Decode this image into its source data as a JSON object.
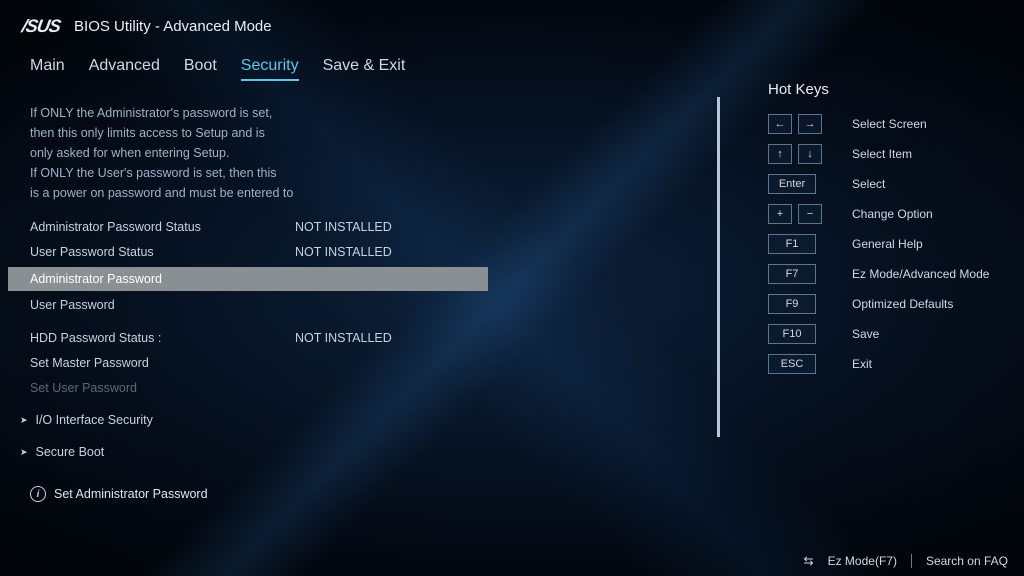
{
  "header": {
    "logo": "/SUS",
    "title": "BIOS Utility - Advanced Mode"
  },
  "tabs": [
    {
      "label": "Main"
    },
    {
      "label": "Advanced"
    },
    {
      "label": "Boot"
    },
    {
      "label": "Security",
      "active": true
    },
    {
      "label": "Save & Exit"
    }
  ],
  "security": {
    "description": [
      "If ONLY the Administrator's password is set,",
      "then this only limits access to Setup and is",
      "only asked for when entering Setup.",
      "If ONLY the User's password is set, then this",
      "is a power on password and must be entered to"
    ],
    "admin_status_label": "Administrator Password Status",
    "admin_status_value": "NOT INSTALLED",
    "user_status_label": "User Password Status",
    "user_status_value": "NOT INSTALLED",
    "admin_password": "Administrator Password",
    "user_password": "User Password",
    "hdd_status_label": "HDD Password Status  :",
    "hdd_status_value": "NOT INSTALLED",
    "set_master": "Set Master Password",
    "set_user": "Set User Password",
    "io_interface": "I/O Interface Security",
    "secure_boot": "Secure Boot",
    "info_text": "Set Administrator Password"
  },
  "hotkeys": {
    "title": "Hot Keys",
    "rows": [
      {
        "keys": [
          "←",
          "→"
        ],
        "label": "Select Screen"
      },
      {
        "keys": [
          "↑",
          "↓"
        ],
        "label": "Select Item"
      },
      {
        "keys": [
          "Enter"
        ],
        "wide": true,
        "label": "Select"
      },
      {
        "keys": [
          "+",
          "−"
        ],
        "label": "Change Option"
      },
      {
        "keys": [
          "F1"
        ],
        "wide": true,
        "label": "General Help"
      },
      {
        "keys": [
          "F7"
        ],
        "wide": true,
        "label": "Ez Mode/Advanced Mode"
      },
      {
        "keys": [
          "F9"
        ],
        "wide": true,
        "label": "Optimized Defaults"
      },
      {
        "keys": [
          "F10"
        ],
        "wide": true,
        "label": "Save"
      },
      {
        "keys": [
          "ESC"
        ],
        "wide": true,
        "label": "Exit"
      }
    ]
  },
  "footer": {
    "ez_mode": "Ez Mode(F7)",
    "search": "Search on FAQ"
  }
}
